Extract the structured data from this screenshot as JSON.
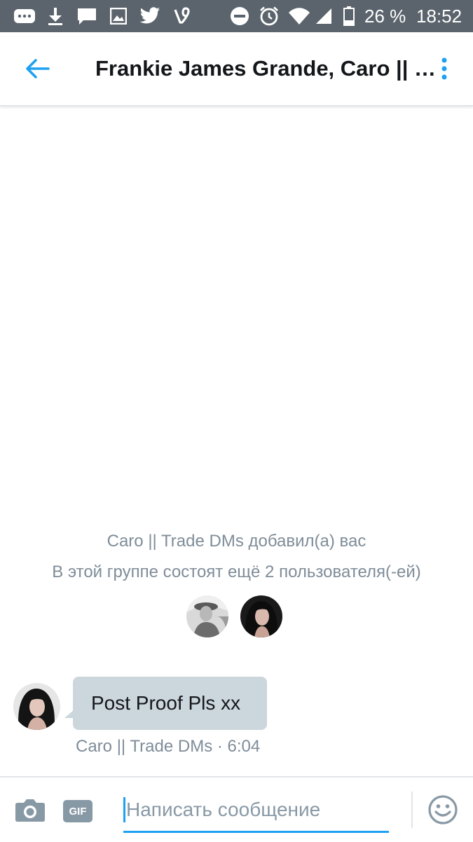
{
  "status_bar": {
    "icons": [
      "chat-bubble-dots-icon",
      "download-icon",
      "message-icon",
      "image-icon",
      "twitter-bird-icon",
      "vine-icon",
      "do-not-disturb-icon",
      "alarm-icon",
      "wifi-icon",
      "cell-signal-icon",
      "battery-icon"
    ],
    "battery": "26 %",
    "time": "18:52"
  },
  "header": {
    "title": "Frankie James Grande, Caro || Trade DMs",
    "back_icon": "back-arrow-icon",
    "menu_icon": "more-vertical-icon"
  },
  "conversation": {
    "added_notice": "Caro || Trade DMs добавил(а) вас",
    "members_notice": "В этой группе состоят ещё 2 пользователя(-ей)",
    "member_avatars": [
      "avatar-member-1",
      "avatar-member-2"
    ],
    "messages": [
      {
        "text": "Post Proof Pls xx",
        "sender": "Caro || Trade DMs",
        "time": "6:04",
        "meta": "Caro || Trade DMs · 6:04"
      }
    ]
  },
  "composer": {
    "camera_icon": "camera-icon",
    "gif_label": "GIF",
    "placeholder": "Написать сообщение",
    "emoji_icon": "emoji-icon"
  },
  "colors": {
    "accent": "#1da1f2",
    "status_bar": "#5b646c",
    "bubble": "#ccd6dd",
    "muted_text": "#7f8d99"
  }
}
